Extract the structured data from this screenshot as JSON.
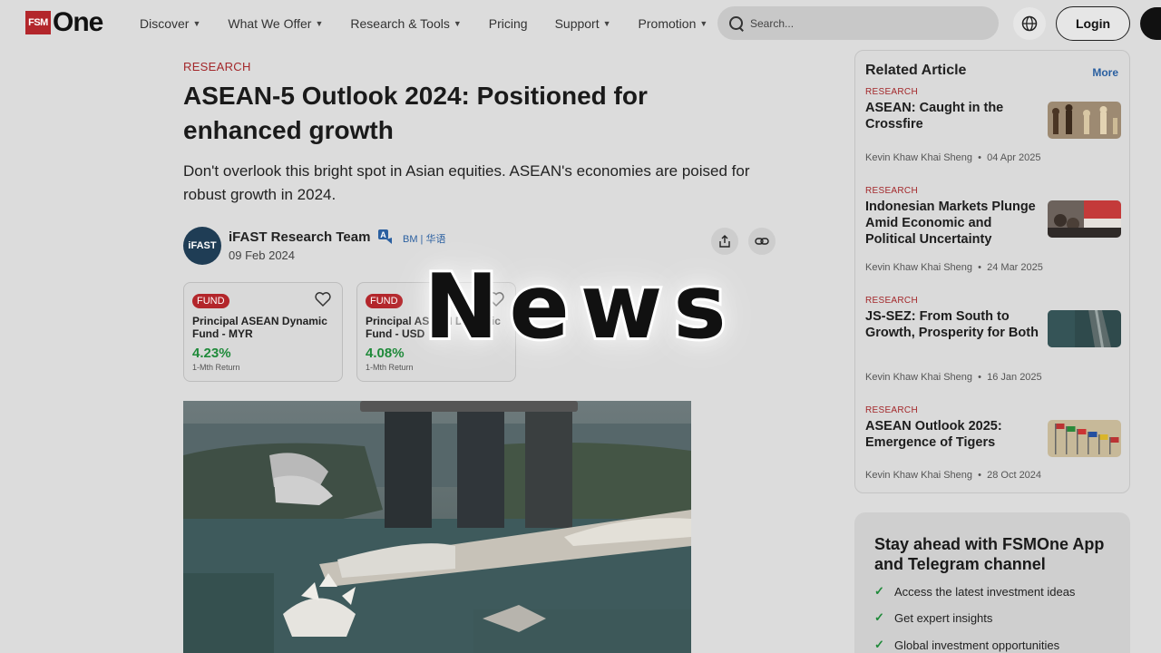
{
  "header": {
    "logo_box": "FSM",
    "logo_text": "One",
    "nav": [
      {
        "label": "Discover",
        "has_menu": true
      },
      {
        "label": "What We Offer",
        "has_menu": true
      },
      {
        "label": "Research & Tools",
        "has_menu": true
      },
      {
        "label": "Pricing",
        "has_menu": false
      },
      {
        "label": "Support",
        "has_menu": true
      },
      {
        "label": "Promotion",
        "has_menu": true
      }
    ],
    "search_placeholder": "Search...",
    "login_label": "Login"
  },
  "article": {
    "category": "RESEARCH",
    "title": "ASEAN-5 Outlook 2024: Positioned for enhanced growth",
    "subtitle": "Don't overlook this bright spot in Asian equities. ASEAN's economies are poised for robust growth in 2024.",
    "author_avatar": "iFAST",
    "author": "iFAST Research Team",
    "date": "09 Feb 2024",
    "languages": "BM | 华语"
  },
  "funds": [
    {
      "tag": "FUND",
      "name": "Principal ASEAN Dynamic Fund - MYR",
      "return": "4.23%",
      "return_label": "1-Mth Return"
    },
    {
      "tag": "FUND",
      "name": "Principal ASEAN Dynamic Fund - USD",
      "return": "4.08%",
      "return_label": "1-Mth Return"
    }
  ],
  "related": {
    "heading": "Related Article",
    "more": "More",
    "items": [
      {
        "category": "RESEARCH",
        "title": "ASEAN: Caught in the Crossfire",
        "author": "Kevin Khaw Khai Sheng",
        "date": "04 Apr 2025"
      },
      {
        "category": "RESEARCH",
        "title": "Indonesian Markets Plunge Amid Economic and Political Uncertainty",
        "author": "Kevin Khaw Khai Sheng",
        "date": "24 Mar 2025"
      },
      {
        "category": "RESEARCH",
        "title": "JS-SEZ: From South to Growth, Prosperity for Both",
        "author": "Kevin Khaw Khai Sheng",
        "date": "16 Jan 2025"
      },
      {
        "category": "RESEARCH",
        "title": "ASEAN Outlook 2025: Emergence of Tigers",
        "author": "Kevin Khaw Khai Sheng",
        "date": "28 Oct 2024"
      }
    ]
  },
  "promo": {
    "heading": "Stay ahead with FSMOne App and Telegram channel",
    "points": [
      "Access the latest investment ideas",
      "Get expert insights",
      "Global investment opportunities"
    ]
  },
  "overlay": {
    "text": "News"
  },
  "colors": {
    "brand_red": "#b3262b",
    "positive_green": "#1f8a3a",
    "link_blue": "#2a5fa0"
  }
}
